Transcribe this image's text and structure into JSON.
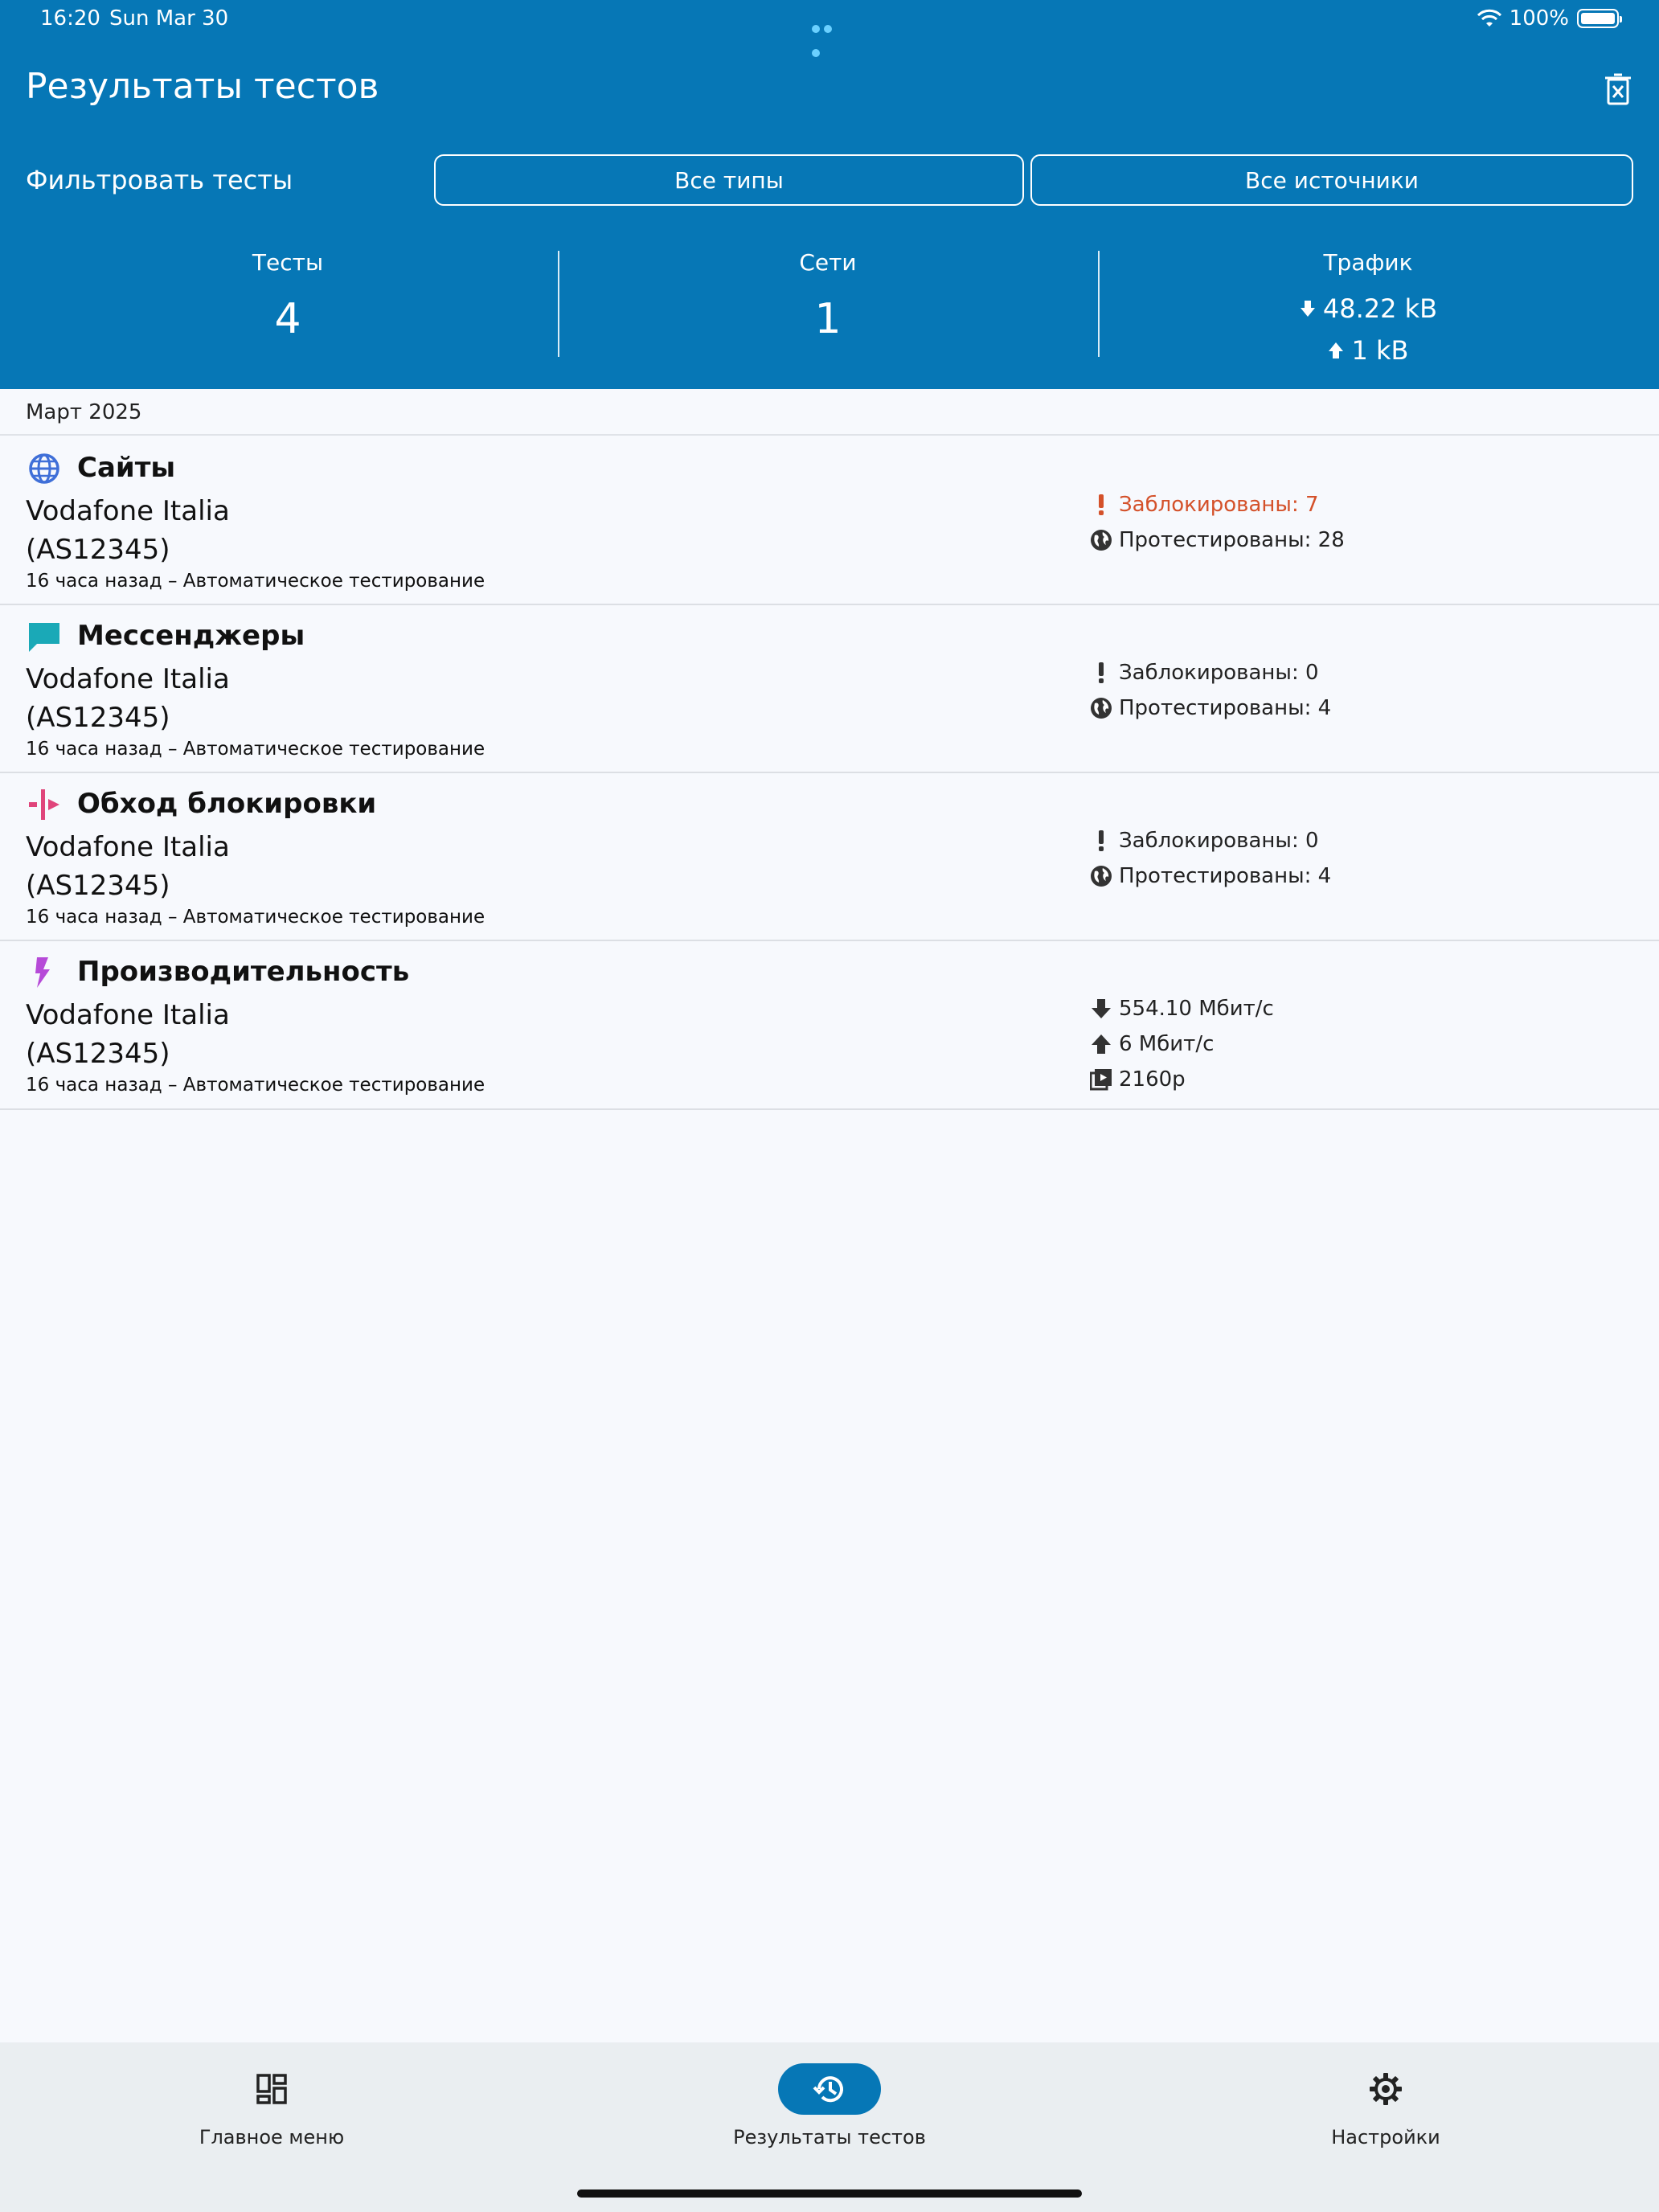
{
  "statusbar": {
    "time": "16:20",
    "date": "Sun Mar 30",
    "battery": "100%"
  },
  "header": {
    "title": "Результаты тестов",
    "filter_label": "Фильтровать тесты",
    "filter_types": "Все типы",
    "filter_sources": "Все источники"
  },
  "stats": {
    "tests_label": "Тесты",
    "tests_value": "4",
    "networks_label": "Сети",
    "networks_value": "1",
    "traffic_label": "Трафик",
    "traffic_down": "48.22 kB",
    "traffic_up": "1 kB"
  },
  "section": {
    "month": "Март 2025"
  },
  "rows": [
    {
      "name": "Сайты",
      "network": "Vodafone Italia",
      "asn": "(AS12345)",
      "meta": "16 часа назад – Автоматическое тестирование",
      "blocked": "Заблокированы: 7",
      "tested": "Протестированы: 28"
    },
    {
      "name": "Мессенджеры",
      "network": "Vodafone Italia",
      "asn": "(AS12345)",
      "meta": "16 часа назад – Автоматическое тестирование",
      "blocked": "Заблокированы: 0",
      "tested": "Протестированы: 4"
    },
    {
      "name": "Обход блокировки",
      "network": "Vodafone Italia",
      "asn": "(AS12345)",
      "meta": "16 часа назад – Автоматическое тестирование",
      "blocked": "Заблокированы: 0",
      "tested": "Протестированы: 4"
    },
    {
      "name": "Производительность",
      "network": "Vodafone Italia",
      "asn": "(AS12345)",
      "meta": "16 часа назад – Автоматическое тестирование",
      "download": "554.10 Мбит/с",
      "upload": "6 Мбит/с",
      "video": "2160p"
    }
  ],
  "nav": {
    "home": "Главное меню",
    "results": "Результаты тестов",
    "settings": "Настройки"
  },
  "colors": {
    "header_bg": "#0677b6",
    "websites_icon": "#3f6fd8",
    "messengers_icon": "#1aa9b7",
    "circumvention_icon": "#e0457b",
    "performance_icon": "#b64ad8",
    "blocked_alert": "#d4512a"
  },
  "icons": [
    "wifi-icon",
    "battery-icon",
    "trash-icon",
    "globe-icon",
    "chat-icon",
    "circumvention-icon",
    "bolt-icon",
    "exclamation-icon",
    "world-icon",
    "download-icon",
    "upload-icon",
    "video-icon",
    "dashboard-icon",
    "history-icon",
    "gear-icon"
  ]
}
